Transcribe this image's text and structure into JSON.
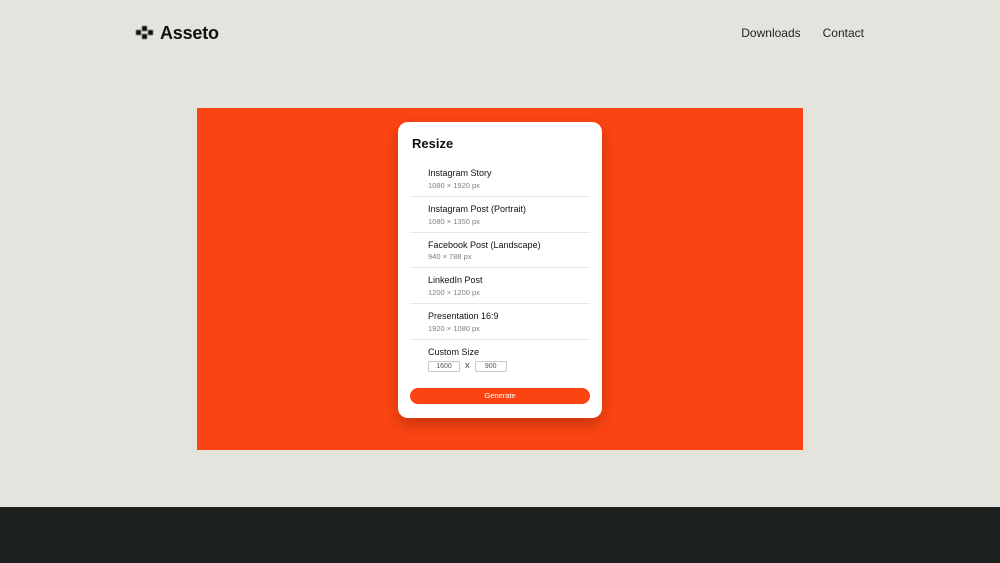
{
  "nav": {
    "brand": "Asseto",
    "links": [
      {
        "label": "Downloads"
      },
      {
        "label": "Contact"
      }
    ]
  },
  "card": {
    "title": "Resize",
    "presets": [
      {
        "name": "Instagram Story",
        "dims": "1080 × 1920 px"
      },
      {
        "name": "Instagram Post (Portrait)",
        "dims": "1080 × 1350 px"
      },
      {
        "name": "Facebook Post (Landscape)",
        "dims": "940 × 788 px"
      },
      {
        "name": "LinkedIn Post",
        "dims": "1200 × 1200 px"
      },
      {
        "name": "Presentation 16:9",
        "dims": "1920 × 1080 px"
      }
    ],
    "custom": {
      "title": "Custom Size",
      "width": "1600",
      "separator": "X",
      "height": "900"
    },
    "generate_label": "Generate"
  },
  "colors": {
    "page_bg": "#e5e3dd",
    "panel": "#fb4412",
    "card": "#ffffff",
    "footer": "#1b201d"
  }
}
